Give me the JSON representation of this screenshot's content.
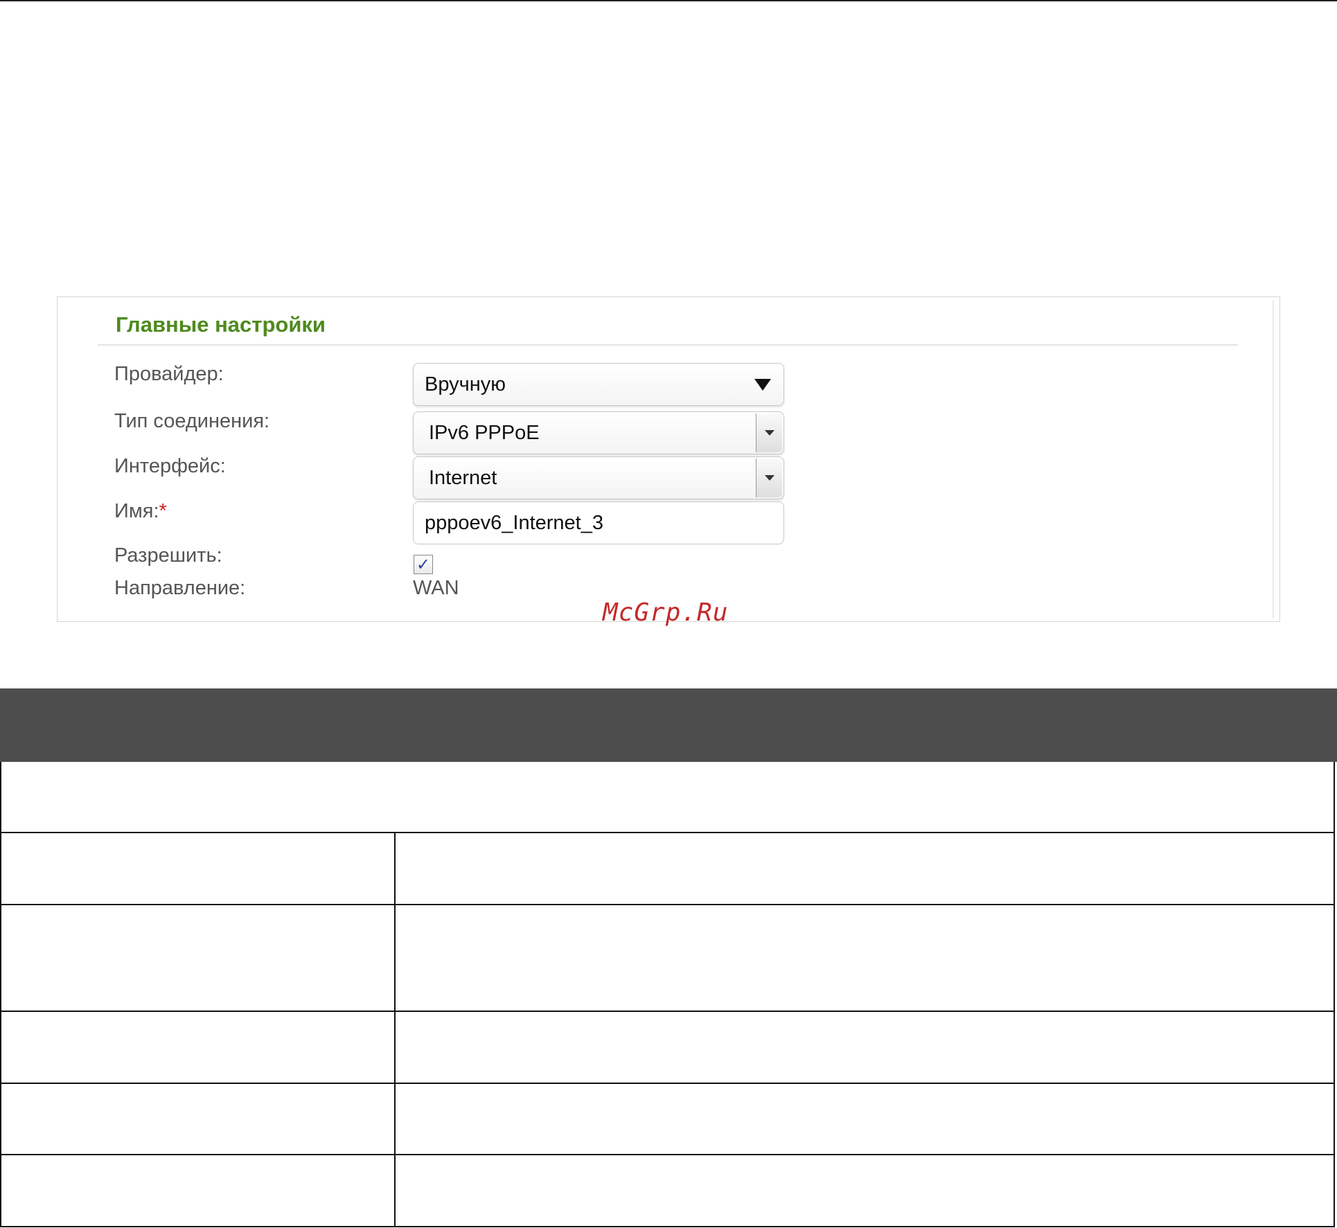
{
  "panel": {
    "title": "Главные настройки",
    "fields": {
      "provider": {
        "label": "Провайдер:",
        "value": "Вручную"
      },
      "connection_type": {
        "label": "Тип соединения:",
        "value": "IPv6 PPPoE"
      },
      "interface": {
        "label": "Интерфейс:",
        "value": "Internet"
      },
      "name": {
        "label": "Имя:",
        "required_mark": "*",
        "value": "pppoev6_Internet_3"
      },
      "enable": {
        "label": "Разрешить:",
        "checked": true,
        "check_glyph": "✓"
      },
      "direction": {
        "label": "Направление:",
        "value": "WAN"
      }
    }
  },
  "watermark": "McGrp.Ru",
  "colors": {
    "title_green": "#4f8a1e",
    "table_header": "#4d4d4d",
    "required": "#d02020"
  },
  "table": {
    "header_cells": [],
    "rows": 6
  }
}
